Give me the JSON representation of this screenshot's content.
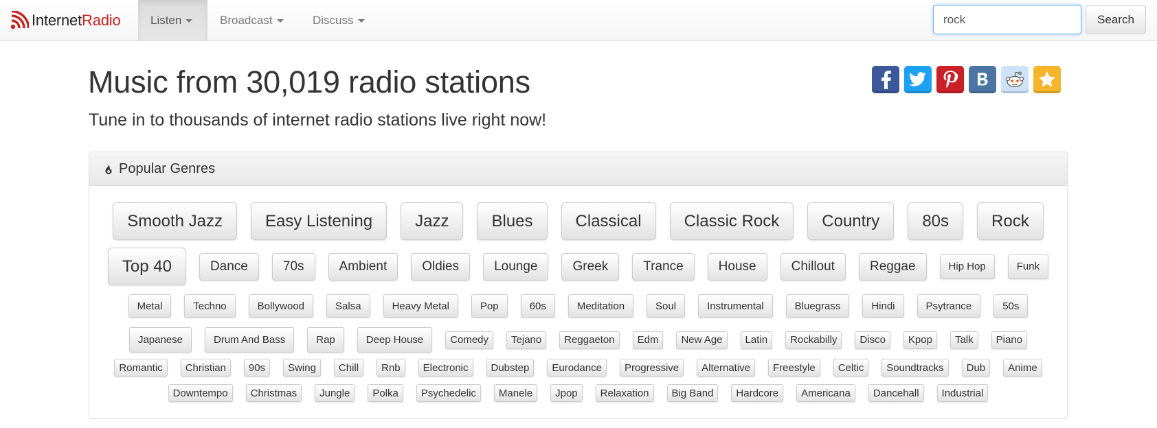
{
  "brand": {
    "part1": "Internet",
    "part2": "Radio"
  },
  "nav": [
    {
      "label": "Listen",
      "active": true
    },
    {
      "label": "Broadcast",
      "active": false
    },
    {
      "label": "Discuss",
      "active": false
    }
  ],
  "search": {
    "value": "rock",
    "button": "Search"
  },
  "hero": {
    "title": "Music from 30,019 radio stations",
    "subtitle": "Tune in to thousands of internet radio stations live right now!"
  },
  "share_icons": [
    "facebook-icon",
    "twitter-icon",
    "pinterest-icon",
    "vk-icon",
    "reddit-icon",
    "favorite-star-icon"
  ],
  "colors": {
    "brand_red": "#c5221f",
    "facebook": "#3b5998",
    "twitter": "#1da1f2",
    "pinterest": "#cb2027",
    "vk": "#4c75a3",
    "reddit": "#cee3f8",
    "star": "#f7b52c"
  },
  "genres_panel": {
    "title": "Popular Genres",
    "icon": "fire-icon",
    "rows": [
      {
        "size": "xl",
        "items": [
          "Smooth Jazz",
          "Easy Listening",
          "Jazz",
          "Blues",
          "Classical",
          "Classic Rock",
          "Country",
          "80s",
          "Rock"
        ]
      },
      {
        "size": "mixed",
        "items": [
          "Top 40",
          "Dance",
          "70s",
          "Ambient",
          "Oldies",
          "Lounge",
          "Greek",
          "Trance",
          "House",
          "Chillout",
          "Reggae",
          "Hip Hop",
          "Funk"
        ]
      },
      {
        "size": "md",
        "items": [
          "Metal",
          "Techno",
          "Bollywood",
          "Salsa",
          "Heavy Metal",
          "Pop",
          "60s",
          "Meditation",
          "Soul",
          "Instrumental",
          "Bluegrass",
          "Hindi",
          "Psytrance",
          "50s"
        ]
      },
      {
        "size": "mixed",
        "items": [
          "Japanese",
          "Drum And Bass",
          "Rap",
          "Deep House",
          "Comedy",
          "Tejano",
          "Reggaeton",
          "Edm",
          "New Age",
          "Latin",
          "Rockabilly",
          "Disco",
          "Kpop",
          "Talk",
          "Piano"
        ]
      },
      {
        "size": "sm",
        "items": [
          "Romantic",
          "Christian",
          "90s",
          "Swing",
          "Chill",
          "Rnb",
          "Electronic",
          "Dubstep",
          "Eurodance",
          "Progressive",
          "Alternative",
          "Freestyle",
          "Celtic",
          "Soundtracks",
          "Dub",
          "Anime"
        ]
      },
      {
        "size": "sm",
        "items": [
          "Downtempo",
          "Christmas",
          "Jungle",
          "Polka",
          "Psychedelic",
          "Manele",
          "Jpop",
          "Relaxation",
          "Big Band",
          "Hardcore",
          "Americana",
          "Dancehall",
          "Industrial"
        ]
      }
    ]
  }
}
